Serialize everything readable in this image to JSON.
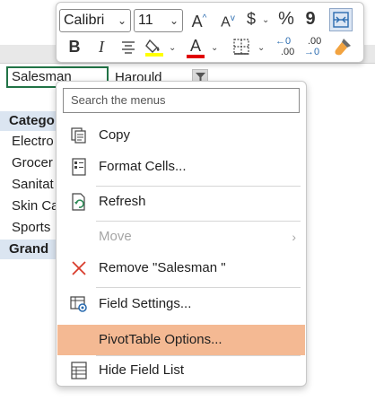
{
  "sheet": {
    "selected_cell": "Salesman",
    "selected_value": "Harould",
    "category_header": "Catego",
    "rows": [
      "Electro",
      "Grocer",
      "Sanitat",
      "Skin Ca",
      "Sports"
    ],
    "grand_total": "Grand"
  },
  "mini_toolbar": {
    "font_name": "Calibri",
    "font_size": "11",
    "increase_font": "A",
    "decrease_font": "A",
    "currency": "$",
    "percent": "%",
    "comma": "9",
    "bold": "B",
    "italic": "I",
    "font_color_letter": "A",
    "increase_decimal": ".00",
    "decrease_decimal": ".00",
    "accent_fill": "#ffff00",
    "accent_font": "#e00000"
  },
  "context_menu": {
    "search_placeholder": "Search the menus",
    "items": [
      {
        "label": "Copy",
        "icon": "copy-icon"
      },
      {
        "label": "Format Cells...",
        "icon": "format-cells-icon"
      },
      {
        "label": "Refresh",
        "icon": "refresh-icon"
      },
      {
        "label": "Move",
        "icon": "none",
        "disabled": true
      },
      {
        "label": "Remove \"Salesman \"",
        "icon": "remove-icon"
      },
      {
        "label": "Field Settings...",
        "icon": "field-settings-icon"
      },
      {
        "label": "PivotTable Options...",
        "icon": "none",
        "highlighted": true
      },
      {
        "label": "Hide Field List",
        "icon": "field-list-icon"
      }
    ],
    "highlight_color": "#f4b993"
  }
}
